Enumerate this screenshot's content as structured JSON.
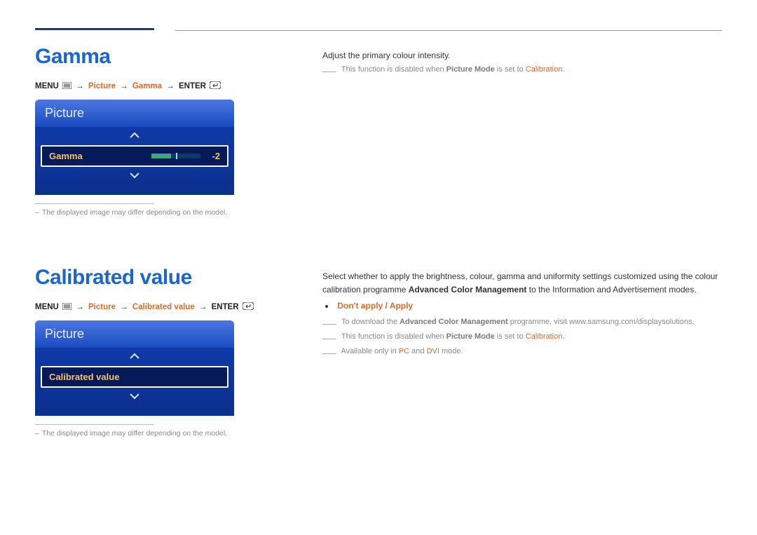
{
  "section1": {
    "title": "Gamma",
    "breadcrumb": {
      "menu": "MENU",
      "picture": "Picture",
      "item": "Gamma",
      "enter": "ENTER"
    },
    "osd": {
      "header": "Picture",
      "row_label": "Gamma",
      "row_value": "-2",
      "slider_fill_pct": 40,
      "slider_tick_pct": 50
    },
    "caption": "The displayed image may differ depending on the model.",
    "desc": "Adjust the primary colour intensity.",
    "note1_pre": "This function is disabled when ",
    "note1_bold1": "Picture Mode",
    "note1_mid": " is set to ",
    "note1_orange": "Calibration",
    "note1_post": "."
  },
  "section2": {
    "title": "Calibrated value",
    "breadcrumb": {
      "menu": "MENU",
      "picture": "Picture",
      "item": "Calibrated value",
      "enter": "ENTER"
    },
    "osd": {
      "header": "Picture",
      "row_label": "Calibrated value"
    },
    "caption": "The displayed image may differ depending on the model.",
    "desc_pre": "Select whether to apply the brightness, colour, gamma and uniformity settings customized using the colour calibration programme ",
    "desc_bold": "Advanced Color Management",
    "desc_post": " to the Information and Advertisement modes.",
    "options_a": "Don't apply",
    "options_sep": " / ",
    "options_b": "Apply",
    "note_dl_pre": "To download the ",
    "note_dl_bold": "Advanced Color Management",
    "note_dl_post": " programme, visit www.samsung.com/displaysolutions.",
    "note2_pre": "This function is disabled when ",
    "note2_bold1": "Picture Mode",
    "note2_mid": " is set to ",
    "note2_orange": "Calibration",
    "note2_post": ".",
    "note3_pre": "Available only in ",
    "note3_orange1": "PC",
    "note3_mid": " and ",
    "note3_orange2": "DVI",
    "note3_post": " mode."
  }
}
